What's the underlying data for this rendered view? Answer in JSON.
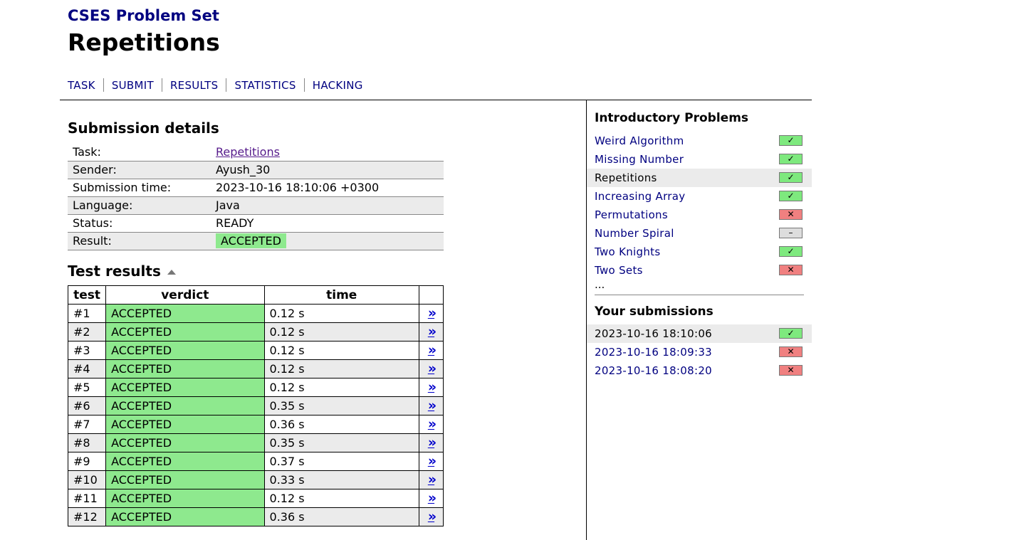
{
  "site_title": "CSES Problem Set",
  "page_title": "Repetitions",
  "nav": [
    "TASK",
    "SUBMIT",
    "RESULTS",
    "STATISTICS",
    "HACKING"
  ],
  "submission": {
    "heading": "Submission details",
    "rows": [
      {
        "label": "Task:",
        "value": "Repetitions",
        "kind": "link"
      },
      {
        "label": "Sender:",
        "value": "Ayush_30"
      },
      {
        "label": "Submission time:",
        "value": "2023-10-16 18:10:06 +0300"
      },
      {
        "label": "Language:",
        "value": "Java"
      },
      {
        "label": "Status:",
        "value": "READY"
      },
      {
        "label": "Result:",
        "value": "ACCEPTED",
        "kind": "badge"
      }
    ]
  },
  "tests": {
    "heading": "Test results",
    "headers": [
      "test",
      "verdict",
      "time",
      ""
    ],
    "link_glyph": "»",
    "rows": [
      {
        "id": "#1",
        "verdict": "ACCEPTED",
        "time": "0.12 s"
      },
      {
        "id": "#2",
        "verdict": "ACCEPTED",
        "time": "0.12 s"
      },
      {
        "id": "#3",
        "verdict": "ACCEPTED",
        "time": "0.12 s"
      },
      {
        "id": "#4",
        "verdict": "ACCEPTED",
        "time": "0.12 s"
      },
      {
        "id": "#5",
        "verdict": "ACCEPTED",
        "time": "0.12 s"
      },
      {
        "id": "#6",
        "verdict": "ACCEPTED",
        "time": "0.35 s"
      },
      {
        "id": "#7",
        "verdict": "ACCEPTED",
        "time": "0.36 s"
      },
      {
        "id": "#8",
        "verdict": "ACCEPTED",
        "time": "0.35 s"
      },
      {
        "id": "#9",
        "verdict": "ACCEPTED",
        "time": "0.37 s"
      },
      {
        "id": "#10",
        "verdict": "ACCEPTED",
        "time": "0.33 s"
      },
      {
        "id": "#11",
        "verdict": "ACCEPTED",
        "time": "0.12 s"
      },
      {
        "id": "#12",
        "verdict": "ACCEPTED",
        "time": "0.36 s"
      }
    ]
  },
  "sidebar": {
    "heading": "Introductory Problems",
    "problems": [
      {
        "name": "Weird Algorithm",
        "status": "ok"
      },
      {
        "name": "Missing Number",
        "status": "ok"
      },
      {
        "name": "Repetitions",
        "status": "ok",
        "current": true
      },
      {
        "name": "Increasing Array",
        "status": "ok"
      },
      {
        "name": "Permutations",
        "status": "bad"
      },
      {
        "name": "Number Spiral",
        "status": "none"
      },
      {
        "name": "Two Knights",
        "status": "ok"
      },
      {
        "name": "Two Sets",
        "status": "bad"
      }
    ],
    "more": "...",
    "submissions_heading": "Your submissions",
    "submissions": [
      {
        "time": "2023-10-16 18:10:06",
        "status": "ok",
        "current": true
      },
      {
        "time": "2023-10-16 18:09:33",
        "status": "bad"
      },
      {
        "time": "2023-10-16 18:08:20",
        "status": "bad"
      }
    ]
  },
  "status_glyphs": {
    "ok": "✓",
    "bad": "✕",
    "none": "–"
  },
  "colors": {
    "accepted": "#8ee98e",
    "rejected": "#f08080",
    "link": "#000080",
    "row_alt": "#ebebeb"
  }
}
